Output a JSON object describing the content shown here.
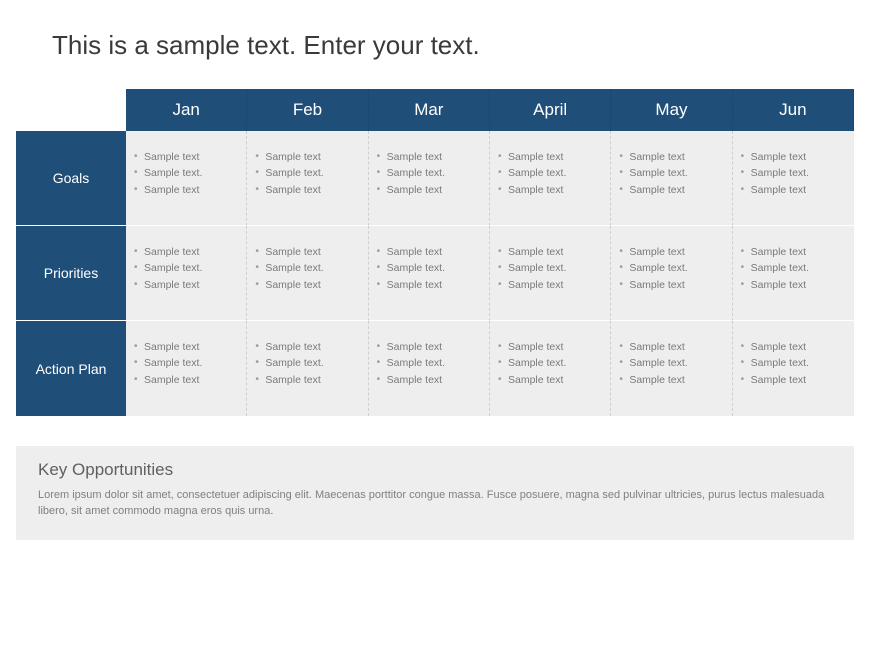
{
  "title": "This is a sample text. Enter your text.",
  "months": [
    "Jan",
    "Feb",
    "Mar",
    "April",
    "May",
    "Jun"
  ],
  "rows": [
    {
      "label": "Goals",
      "cells": [
        [
          "Sample text",
          "Sample text.",
          "Sample text"
        ],
        [
          "Sample text",
          "Sample text.",
          "Sample text"
        ],
        [
          "Sample text",
          "Sample text.",
          "Sample text"
        ],
        [
          "Sample text",
          "Sample text.",
          "Sample text"
        ],
        [
          "Sample text",
          "Sample text.",
          "Sample text"
        ],
        [
          "Sample text",
          "Sample text.",
          "Sample text"
        ]
      ]
    },
    {
      "label": "Priorities",
      "cells": [
        [
          "Sample text",
          "Sample text.",
          "Sample text"
        ],
        [
          "Sample text",
          "Sample text.",
          "Sample text"
        ],
        [
          "Sample text",
          "Sample text.",
          "Sample text"
        ],
        [
          "Sample text",
          "Sample text.",
          "Sample text"
        ],
        [
          "Sample text",
          "Sample text.",
          "Sample text"
        ],
        [
          "Sample text",
          "Sample text.",
          "Sample text"
        ]
      ]
    },
    {
      "label": "Action Plan",
      "cells": [
        [
          "Sample text",
          "Sample text.",
          "Sample text"
        ],
        [
          "Sample text",
          "Sample text.",
          "Sample text"
        ],
        [
          "Sample text",
          "Sample text.",
          "Sample text"
        ],
        [
          "Sample text",
          "Sample text.",
          "Sample text"
        ],
        [
          "Sample text",
          "Sample text.",
          "Sample text"
        ],
        [
          "Sample text",
          "Sample text.",
          "Sample text"
        ]
      ]
    }
  ],
  "footer": {
    "title": "Key Opportunities",
    "text": "Lorem ipsum dolor sit amet, consectetuer adipiscing elit. Maecenas porttitor congue massa. Fusce posuere, magna sed pulvinar ultricies, purus lectus malesuada libero, sit amet commodo magna eros quis urna."
  }
}
